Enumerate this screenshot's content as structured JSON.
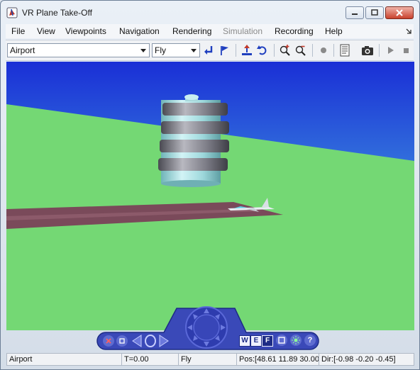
{
  "window": {
    "title": "VR Plane Take-Off"
  },
  "menubar": {
    "items": [
      {
        "label": "File",
        "enabled": true
      },
      {
        "label": "View",
        "enabled": true
      },
      {
        "label": "Viewpoints",
        "enabled": true
      },
      {
        "label": "Navigation",
        "enabled": true
      },
      {
        "label": "Rendering",
        "enabled": true
      },
      {
        "label": "Simulation",
        "enabled": false
      },
      {
        "label": "Recording",
        "enabled": true
      },
      {
        "label": "Help",
        "enabled": true
      }
    ]
  },
  "toolbar": {
    "viewpoint_select": "Airport",
    "navigation_select": "Fly"
  },
  "navpanel": {
    "wef_labels": [
      "W",
      "E",
      "F"
    ],
    "help_label": "?"
  },
  "status": {
    "viewpoint": "Airport",
    "time": "T=0.00",
    "nav_mode": "Fly",
    "position": "Pos:[48.61 11.89 30.00]",
    "direction": "Dir:[-0.98 -0.20 -0.45]"
  },
  "colors": {
    "sky_top": "#1a2fd6",
    "sky_bottom": "#54d6e6",
    "ground": "#72d872",
    "runway": "#7a4a5a",
    "nav_panel": "#3a49b8"
  }
}
